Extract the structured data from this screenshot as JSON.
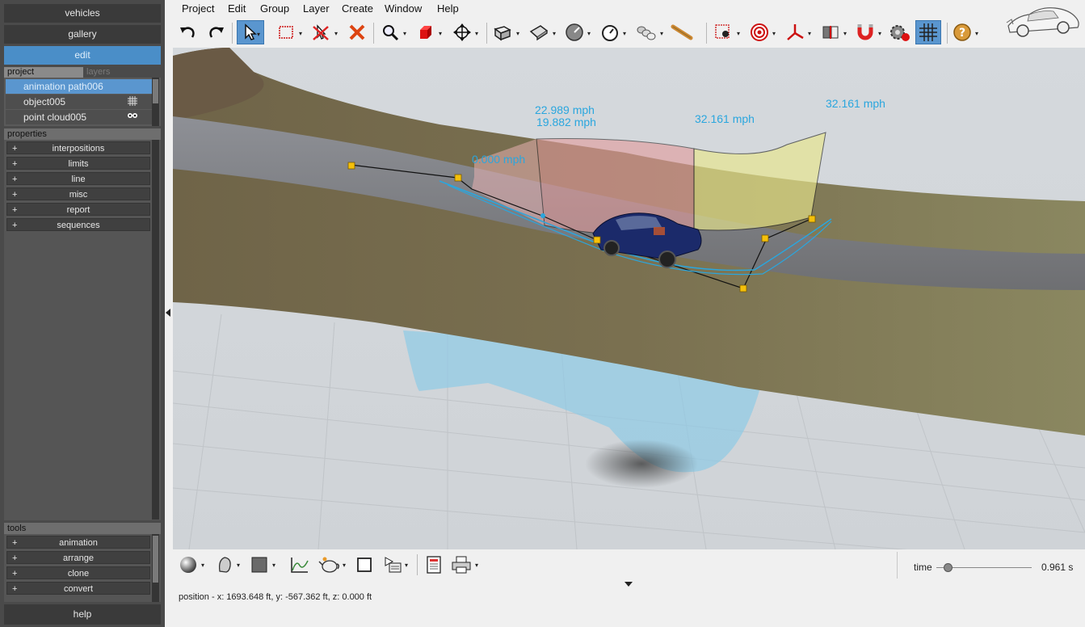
{
  "left_panel": {
    "nav": {
      "vehicles": "vehicles",
      "gallery": "gallery",
      "edit": "edit"
    },
    "tabs": {
      "project": "project",
      "layers": "layers"
    },
    "layer_items": [
      {
        "label": "animation path006",
        "icon": ""
      },
      {
        "label": "object005",
        "icon": "grid-icon"
      },
      {
        "label": "point cloud005",
        "icon": "eye-icon"
      }
    ],
    "properties_label": "properties",
    "properties": [
      "interpositions",
      "limits",
      "line",
      "misc",
      "report",
      "sequences"
    ],
    "tools_label": "tools",
    "tools": [
      "animation",
      "arrange",
      "clone",
      "convert"
    ],
    "help": "help"
  },
  "menu": [
    "Project",
    "Edit",
    "Group",
    "Layer",
    "Create",
    "Window",
    "Help"
  ],
  "viewport": {
    "speed_labels": [
      "22.989 mph",
      "19.882 mph",
      "32.161 mph",
      "32.161 mph",
      "0.000 mph"
    ]
  },
  "timeline": {
    "label": "time",
    "value": "0.961 s",
    "slider_fraction": 0.12
  },
  "status": "position - x: 1693.648 ft, y: -567.362 ft, z: 0.000 ft",
  "colors": {
    "accent": "#5a96cf",
    "speed_label": "#2aa6de",
    "panel_bg": "#4a4a4a"
  }
}
